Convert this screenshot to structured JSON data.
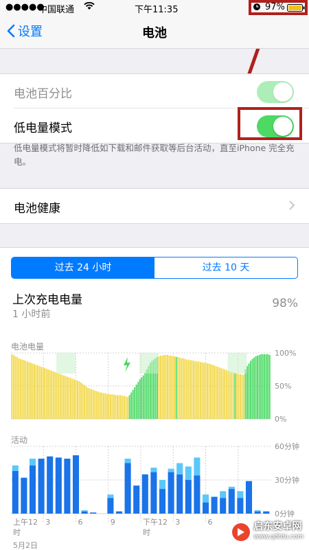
{
  "status_bar": {
    "carrier": "中国联通",
    "time": "下午11:35",
    "battery_percent": "97%"
  },
  "nav": {
    "back_label": "设置",
    "title": "电池"
  },
  "settings": {
    "battery_percentage_label": "电池百分比",
    "low_power_label": "低电量模式",
    "low_power_note": "低电量模式将暂时降低如下载和邮件获取等后台活动，直至iPhone 完全充电。",
    "battery_health_label": "电池健康"
  },
  "segment": {
    "tab1": "过去 24 小时",
    "tab2": "过去 10 天"
  },
  "last_charge": {
    "label": "上次充电电量",
    "ago": "1 小时前",
    "value": "98%"
  },
  "level_chart_title": "电池电量",
  "activity_chart_title": "活动",
  "chart_data": [
    {
      "type": "bar",
      "title": "电池电量",
      "y_ticks": [
        "100%",
        "50%",
        "0%"
      ],
      "ylim": [
        0,
        100
      ],
      "values": [
        98,
        97,
        95,
        94,
        92,
        91,
        90,
        89,
        88,
        87,
        86,
        85,
        84,
        83,
        82,
        81,
        80,
        79,
        78,
        77,
        76,
        75,
        74,
        73,
        72,
        71,
        70,
        69,
        68,
        67,
        66,
        65,
        64,
        63,
        62,
        61,
        60,
        59,
        58,
        57,
        55,
        53,
        51,
        49,
        47,
        46,
        45,
        44,
        43,
        42,
        41,
        40,
        40,
        39,
        39,
        38,
        38,
        37,
        37,
        37,
        36,
        36,
        36,
        36,
        35,
        35,
        34,
        33,
        36,
        40,
        44,
        48,
        52,
        56,
        60,
        63,
        66,
        70,
        75,
        80,
        85,
        88,
        90,
        92,
        94,
        95,
        96,
        96,
        97,
        97,
        97,
        96,
        96,
        95,
        95,
        94,
        94,
        93,
        92,
        92,
        91,
        90,
        90,
        89,
        89,
        88,
        88,
        87,
        87,
        86,
        86,
        85,
        85,
        84,
        84,
        83,
        82,
        81,
        80,
        79,
        78,
        77,
        76,
        75,
        74,
        73,
        72,
        71,
        70,
        69,
        69,
        68,
        68,
        67,
        67,
        75,
        80,
        84,
        88,
        91,
        93,
        95,
        96,
        97,
        98,
        98,
        98,
        98,
        98,
        97
      ],
      "charging": [
        false,
        false,
        false,
        false,
        false,
        false,
        false,
        false,
        false,
        false,
        false,
        false,
        false,
        false,
        false,
        false,
        false,
        false,
        false,
        false,
        false,
        false,
        false,
        false,
        false,
        false,
        false,
        false,
        false,
        false,
        false,
        false,
        false,
        false,
        false,
        false,
        false,
        false,
        false,
        false,
        false,
        false,
        false,
        false,
        false,
        false,
        false,
        false,
        false,
        false,
        false,
        false,
        false,
        false,
        false,
        false,
        false,
        false,
        false,
        false,
        false,
        false,
        false,
        false,
        false,
        false,
        false,
        false,
        true,
        true,
        true,
        true,
        true,
        true,
        true,
        true,
        true,
        true,
        true,
        true,
        true,
        true,
        true,
        true,
        true,
        false,
        false,
        false,
        false,
        false,
        false,
        false,
        false,
        false,
        false,
        true,
        false,
        false,
        false,
        false,
        false,
        false,
        false,
        false,
        false,
        false,
        false,
        false,
        false,
        false,
        false,
        false,
        false,
        false,
        false,
        false,
        false,
        false,
        false,
        false,
        false,
        false,
        false,
        false,
        false,
        false,
        false,
        false,
        false,
        true,
        false,
        false,
        false,
        false,
        false,
        true,
        true,
        true,
        true,
        true,
        true,
        true,
        true,
        true,
        true,
        true,
        true,
        true,
        true,
        true,
        true
      ],
      "colors": {
        "battery": "#f2d84b",
        "charging": "#4cd964"
      }
    },
    {
      "type": "bar",
      "title": "活动",
      "y_ticks": [
        "60分钟",
        "30分钟",
        "0分钟"
      ],
      "ylim": [
        0,
        60
      ],
      "x_ticks": [
        "上午12时",
        "3",
        "6",
        "9",
        "下午12时",
        "3",
        "6"
      ],
      "date_label": "5月2日",
      "screen_on": [
        38,
        32,
        43,
        49,
        51,
        50,
        49,
        52,
        2,
        1,
        0,
        14,
        2,
        45,
        25,
        35,
        37,
        22,
        37,
        35,
        30,
        34,
        10,
        15,
        14,
        22,
        14,
        29,
        2,
        2
      ],
      "screen_off": [
        5,
        0,
        6,
        0,
        0,
        0,
        0,
        0,
        1,
        0,
        0,
        3,
        0,
        4,
        0,
        0,
        4,
        8,
        3,
        10,
        12,
        16,
        7,
        0,
        6,
        2,
        6,
        0,
        1,
        0
      ],
      "colors": {
        "screen_on": "#1a73e8",
        "screen_off": "#5ac8fa"
      }
    }
  ],
  "watermark": {
    "text": "启东安卓网",
    "url": "www.qdtdu.com"
  }
}
